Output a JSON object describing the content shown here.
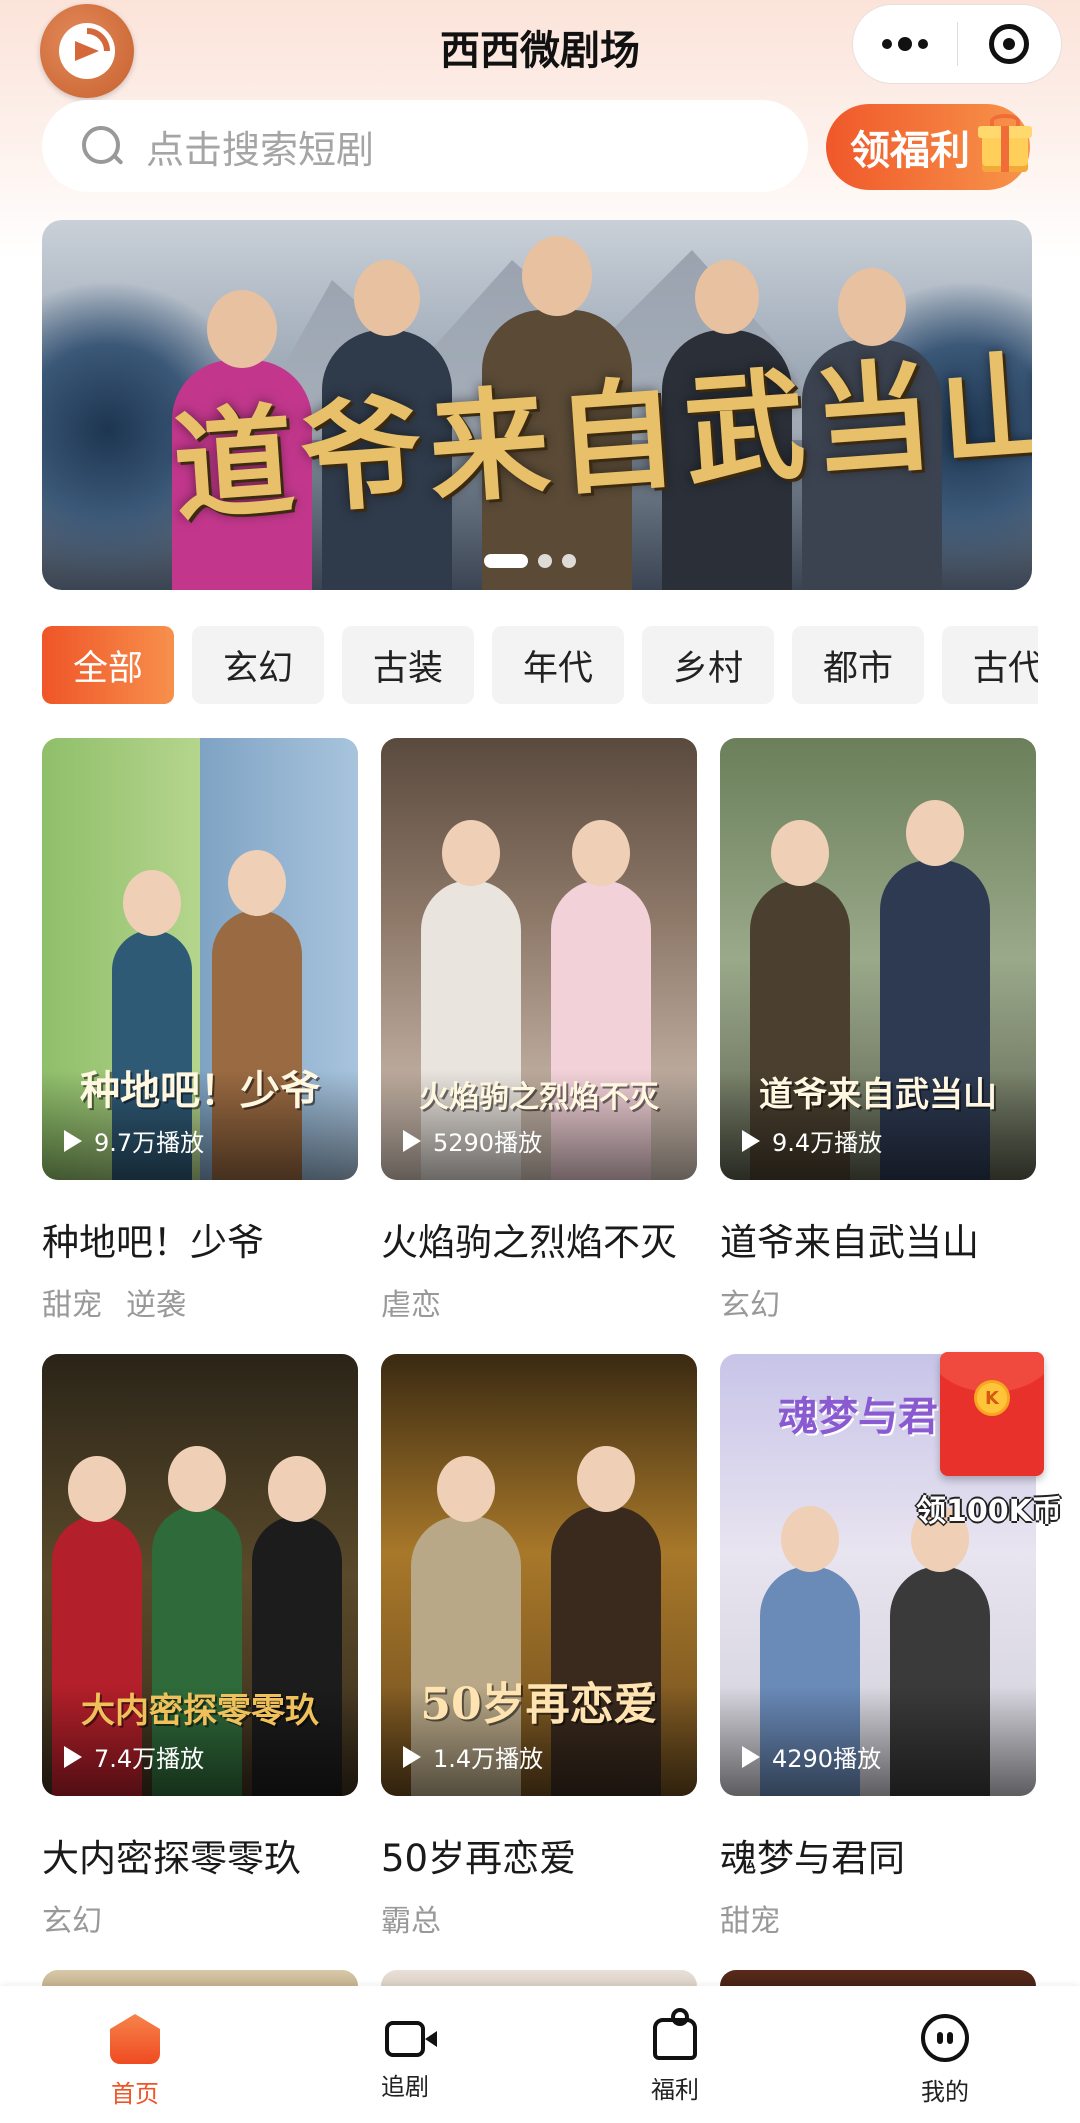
{
  "header": {
    "title": "西西微剧场"
  },
  "search": {
    "placeholder": "点击搜索短剧"
  },
  "welfare_button": {
    "label": "领福利"
  },
  "banner": {
    "title": "道爷来自武当山",
    "page_count": 3,
    "active_page": 1
  },
  "tabs": [
    {
      "label": "全部",
      "active": true
    },
    {
      "label": "玄幻",
      "active": false
    },
    {
      "label": "古装",
      "active": false
    },
    {
      "label": "年代",
      "active": false
    },
    {
      "label": "乡村",
      "active": false
    },
    {
      "label": "都市",
      "active": false
    },
    {
      "label": "古代",
      "active": false
    }
  ],
  "dramas": [
    {
      "title": "种地吧！少爷",
      "poster_text": "种地吧！少爷",
      "plays": "9.7万播放",
      "tags": [
        "甜宠",
        "逆袭"
      ]
    },
    {
      "title": "火焰驹之烈焰不灭",
      "poster_text": "火焰驹之烈焰不灭",
      "plays": "5290播放",
      "tags": [
        "虐恋"
      ]
    },
    {
      "title": "道爷来自武当山",
      "poster_text": "道爷来自武当山",
      "plays": "9.4万播放",
      "tags": [
        "玄幻"
      ]
    },
    {
      "title": "大内密探零零玖",
      "poster_text": "大内密探零零玖",
      "plays": "7.4万播放",
      "tags": [
        "玄幻"
      ]
    },
    {
      "title": "50岁再恋爱",
      "poster_text": "50岁再恋爱",
      "plays": "1.4万播放",
      "tags": [
        "霸总"
      ]
    },
    {
      "title": "魂梦与君同",
      "poster_text": "魂梦与君同",
      "plays": "4290播放",
      "tags": [
        "甜宠"
      ]
    }
  ],
  "red_packet": {
    "coin_letter": "K",
    "label": "领100K币"
  },
  "tabbar": [
    {
      "label": "首页",
      "icon": "home-icon",
      "active": true
    },
    {
      "label": "追剧",
      "icon": "video-icon",
      "active": false
    },
    {
      "label": "福利",
      "icon": "gift-icon",
      "active": false
    },
    {
      "label": "我的",
      "icon": "profile-icon",
      "active": false
    }
  ],
  "colors": {
    "accent": "#ef5528",
    "accent_light": "#f7904c",
    "tag_gray": "#999999"
  }
}
